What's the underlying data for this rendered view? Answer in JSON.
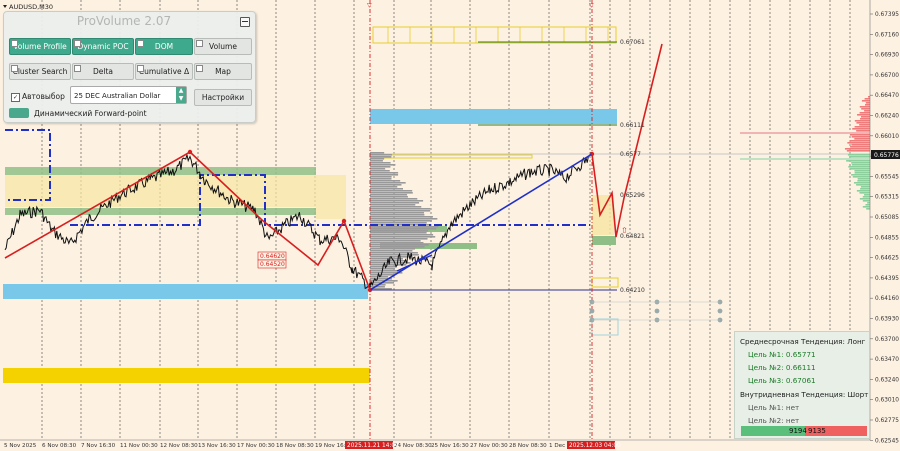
{
  "symbol": "AUDUSD,M30",
  "price_axis": {
    "labels": [
      "0.67395",
      "0.67160",
      "0.66930",
      "0.66700",
      "0.66470",
      "0.66240",
      "0.66010",
      "0.65776",
      "0.65545",
      "0.65315",
      "0.65085",
      "0.64855",
      "0.64625",
      "0.64395",
      "0.64160",
      "0.63930",
      "0.63700",
      "0.63470",
      "0.63240",
      "0.63010",
      "0.62775",
      "0.62545"
    ],
    "current": "0.65776"
  },
  "time_axis": {
    "labels": [
      "5 Nov 2025",
      "6 Nov 08:30",
      "7 Nov 16:30",
      "11 Nov 00:30",
      "12 Nov 08:30",
      "13 Nov 16:30",
      "17 Nov 00:30",
      "18 Nov 08:30",
      "19 Nov 16:30",
      "21 Nov 00:30",
      "24 Nov 08:30",
      "25 Nov 16:30",
      "27 Nov 00:30",
      "28 Nov 08:30",
      "1 Dec 16:30"
    ],
    "markers": [
      "2025.11.21 14:00",
      "2025.12.03 04:00"
    ]
  },
  "level_labels": {
    "l1": "0.67061",
    "l2": "0.66111",
    "l3": "0.6577",
    "l4": "0.65296",
    "l5": "0.64821",
    "l6": "0.64210",
    "box_a": "0.64620",
    "box_b": "0.64520"
  },
  "colors": {
    "background": "#fdf1e2",
    "red": "#e0201d",
    "blue": "#1f2fc8",
    "navy": "#2c2f8e",
    "green_zone": "#8fbf86",
    "cyan_zone": "#79c8ea",
    "yellow_zone": "#f3d200"
  },
  "panel": {
    "title": "ProVolume 2.07",
    "buttons": {
      "volume_profile": "Volume Profile",
      "dynamic_poc": "Dynamic POC",
      "dom": "DOM",
      "volume": "Volume",
      "cluster_search": "Cluster Search",
      "delta": "Delta",
      "cumulative_delta": "Cumulative Δ",
      "map": "Map",
      "settings": "Настройки"
    },
    "autoselect_label": "Автовыбор",
    "autoselect_checked": true,
    "instrument": "25 DEC Australian Dollar",
    "forward_point_label": "Динамический Forward-point"
  },
  "trend": {
    "medium_label": "Среднесрочная Тенденция: Лонг",
    "target1": "Цель №1: 0.65771",
    "target2": "Цель №2: 0.66111",
    "target3": "Цель №3: 0.67061",
    "intraday_label": "Внутридневная Тенденция: Шорт",
    "sell_target1": "Цель №1: нет",
    "sell_target2": "Цель №2: нет",
    "buy_volume": "9194",
    "sell_volume": "9135"
  }
}
